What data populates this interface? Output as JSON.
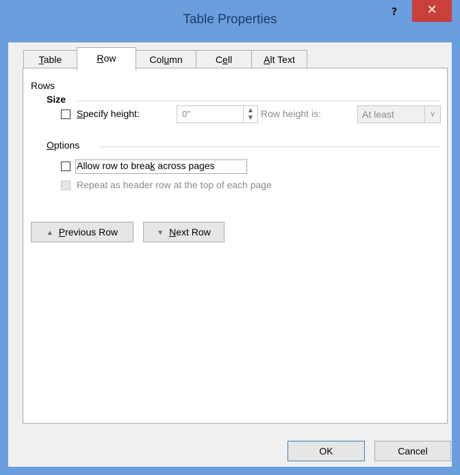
{
  "window": {
    "title": "Table Properties",
    "help_label": "?",
    "close_label": "✕"
  },
  "tabs": [
    {
      "label_pre": "",
      "label_u": "T",
      "label_post": "able"
    },
    {
      "label_pre": "",
      "label_u": "R",
      "label_post": "ow"
    },
    {
      "label_pre": "Col",
      "label_u": "u",
      "label_post": "mn"
    },
    {
      "label_pre": "C",
      "label_u": "e",
      "label_post": "ll"
    },
    {
      "label_pre": "",
      "label_u": "A",
      "label_post": "lt Text"
    }
  ],
  "active_tab": "Row",
  "rows_section": {
    "heading": "Rows",
    "size_heading": "Size",
    "specify_height": {
      "u": "S",
      "rest": "pecify height:",
      "checked": false
    },
    "height_value": "0\"",
    "row_height_is_label": "Row height is:",
    "row_height_is_value": "At least",
    "options_heading_u": "O",
    "options_heading_rest": "ptions",
    "allow_break": {
      "pre": "Allow row to brea",
      "u": "k",
      "post": " across pages",
      "checked": false
    },
    "repeat_header": {
      "label": "Repeat as header row at the top of each page",
      "checked": false,
      "enabled": false
    }
  },
  "nav_buttons": {
    "previous": {
      "u": "P",
      "rest": "revious Row"
    },
    "next": {
      "u": "N",
      "rest": "ext Row"
    }
  },
  "footer": {
    "ok_label": "OK",
    "cancel_label": "Cancel"
  }
}
